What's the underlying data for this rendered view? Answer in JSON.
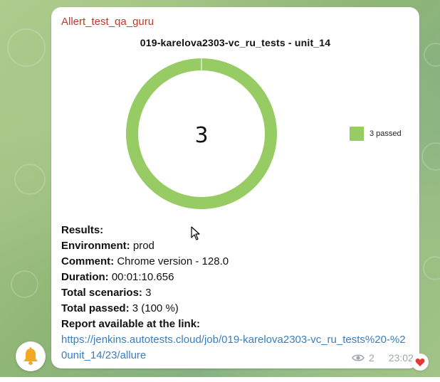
{
  "message": {
    "sender": "Allert_test_qa_guru",
    "views": "2",
    "time": "23:02",
    "reaction": "heart-icon"
  },
  "chart_data": {
    "type": "pie",
    "title": "019-karelova2303-vc_ru_tests - unit_14",
    "center_label": "3",
    "slices": [
      {
        "label": "3 passed",
        "value": 3,
        "color": "#97cc64"
      }
    ],
    "legend_position": "right"
  },
  "details": {
    "results_label": "Results:",
    "environment_label": "Environment:",
    "environment_value": " prod",
    "comment_label": "Comment:",
    "comment_value": " Chrome version - 128.0",
    "duration_label": "Duration:",
    "duration_value": " 00:01:10.656",
    "total_scenarios_label": "Total scenarios:",
    "total_scenarios_value": " 3",
    "total_passed_label": "Total passed:",
    "total_passed_value": " 3 (100 %)",
    "report_label": "Report available at the link:",
    "report_link": "https://jenkins.autotests.cloud/job/019-karelova2303-vc_ru_tests%20-%20unit_14/23/allure"
  },
  "colors": {
    "sender": "#c0392b",
    "link": "#3a7ebf",
    "passed": "#97cc64",
    "bell": "#f5a623",
    "heart": "#e53935"
  }
}
